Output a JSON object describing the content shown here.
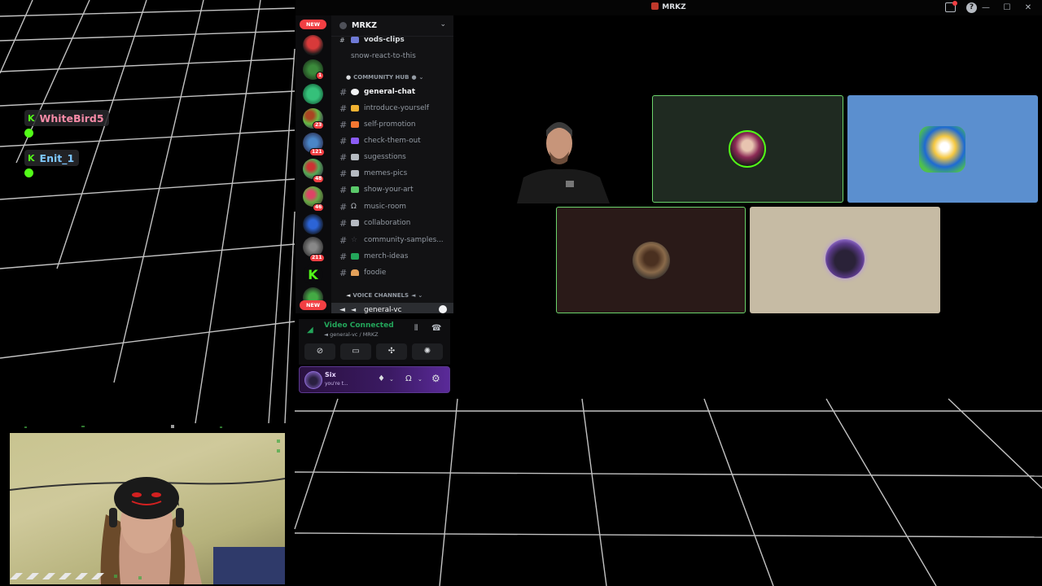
{
  "window": {
    "title": "MRKZ"
  },
  "stream_overlay": {
    "chat_users": [
      {
        "name": "WhiteBird5",
        "color": "#f58aa6"
      },
      {
        "name": "Enit_1",
        "color": "#7ec8ff"
      }
    ]
  },
  "discord": {
    "server": {
      "name": "MRKZ"
    },
    "rail": {
      "new_label": "NEW",
      "badges": [
        "1",
        "23",
        "121",
        "48",
        "46",
        "211"
      ]
    },
    "channels_top": [
      {
        "label": "vods-clips"
      },
      {
        "label": "snow-react-to-this"
      }
    ],
    "community_hub": {
      "label": "COMMUNITY HUB",
      "channels": [
        {
          "label": "general-chat",
          "emoji_color": "#f2f3f5"
        },
        {
          "label": "introduce-yourself",
          "emoji_color": "#f0b232"
        },
        {
          "label": "self-promotion",
          "emoji_color": "#f57731"
        },
        {
          "label": "check-them-out",
          "emoji_color": "#8b5cf6"
        },
        {
          "label": "sugesstions",
          "emoji_color": "#b5bac1"
        },
        {
          "label": "memes-pics",
          "emoji_color": "#b5bac1"
        },
        {
          "label": "show-your-art",
          "emoji_color": "#5ac96a"
        },
        {
          "label": "music-room",
          "emoji_color": "#b5bac1"
        },
        {
          "label": "collaboration",
          "emoji_color": "#b5bac1"
        },
        {
          "label": "community-samples...",
          "emoji_color": "#4e5058"
        },
        {
          "label": "merch-ideas",
          "emoji_color": "#23a55a"
        },
        {
          "label": "foodie",
          "emoji_color": "#e2a05a"
        }
      ]
    },
    "voice_channels": {
      "label": "VOICE CHANNELS",
      "channels": [
        {
          "label": "general-vc"
        }
      ]
    },
    "voice_status": {
      "status": "Video Connected",
      "location": "general-vc / MRKZ"
    },
    "user_panel": {
      "name": "Six",
      "status": "you're t..."
    },
    "video_tiles": [
      {
        "id": "kick-user",
        "bg": "#1f2a21",
        "border": "#6bd46b"
      },
      {
        "id": "blue-user",
        "bg": "#5b8fcf"
      },
      {
        "id": "dark-user",
        "bg": "#2a1a18",
        "border": "#6bd46b"
      },
      {
        "id": "ghost-user",
        "bg": "#c6bba4"
      }
    ]
  }
}
